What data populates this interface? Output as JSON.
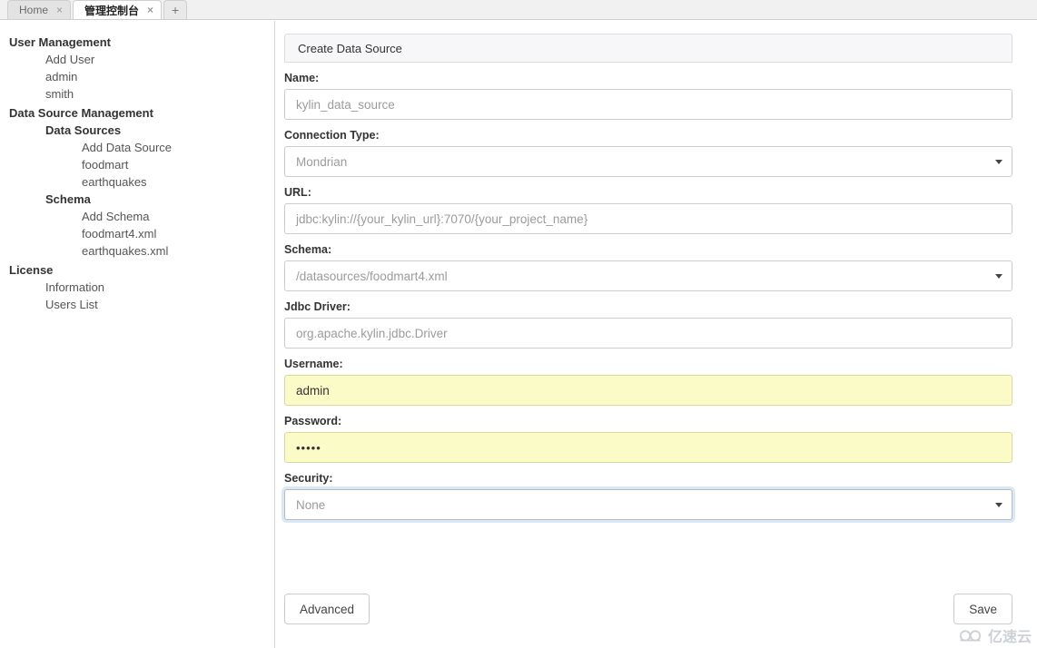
{
  "browser": {
    "tabs": [
      {
        "label": "Home",
        "active": false,
        "close_icon": "×"
      },
      {
        "label": "管理控制台",
        "active": true,
        "close_icon": "×"
      }
    ],
    "new_tab_label": "+"
  },
  "sidebar": {
    "items": [
      {
        "label": "User Management",
        "level": 0,
        "bold": true
      },
      {
        "label": "Add User",
        "level": 1,
        "bold": false
      },
      {
        "label": "admin",
        "level": 1,
        "bold": false
      },
      {
        "label": "smith",
        "level": 1,
        "bold": false
      },
      {
        "label": "Data Source Management",
        "level": 0,
        "bold": true
      },
      {
        "label": "Data Sources",
        "level": 1,
        "bold": true
      },
      {
        "label": "Add Data Source",
        "level": 2,
        "bold": false
      },
      {
        "label": "foodmart",
        "level": 2,
        "bold": false
      },
      {
        "label": "earthquakes",
        "level": 2,
        "bold": false
      },
      {
        "label": "Schema",
        "level": 1,
        "bold": true
      },
      {
        "label": "Add Schema",
        "level": 2,
        "bold": false
      },
      {
        "label": "foodmart4.xml",
        "level": 2,
        "bold": false
      },
      {
        "label": "earthquakes.xml",
        "level": 2,
        "bold": false
      },
      {
        "label": "License",
        "level": 0,
        "bold": true
      },
      {
        "label": "Information",
        "level": 1,
        "bold": false
      },
      {
        "label": "Users List",
        "level": 1,
        "bold": false
      }
    ]
  },
  "panel": {
    "title": "Create Data Source",
    "fields": {
      "name": {
        "label": "Name:",
        "value": "kylin_data_source",
        "placeholder": "kylin_data_source"
      },
      "connection_type": {
        "label": "Connection Type:",
        "value": "Mondrian",
        "options": [
          "Mondrian"
        ]
      },
      "url": {
        "label": "URL:",
        "value": "jdbc:kylin://{your_kylin_url}:7070/{your_project_name}",
        "placeholder": "jdbc:kylin://{your_kylin_url}:7070/{your_project_name}"
      },
      "schema": {
        "label": "Schema:",
        "value": "/datasources/foodmart4.xml",
        "options": [
          "/datasources/foodmart4.xml"
        ]
      },
      "jdbc_driver": {
        "label": "Jdbc Driver:",
        "value": "org.apache.kylin.jdbc.Driver",
        "placeholder": "org.apache.kylin.jdbc.Driver"
      },
      "username": {
        "label": "Username:",
        "value": "admin"
      },
      "password": {
        "label": "Password:",
        "value": "•••••"
      },
      "security": {
        "label": "Security:",
        "value": "None",
        "options": [
          "None"
        ]
      }
    }
  },
  "footer": {
    "advanced_label": "Advanced",
    "save_label": "Save"
  },
  "watermark": {
    "text": "亿速云"
  },
  "colors": {
    "autofill_background": "#fbfbc8",
    "autofill_border": "#d8d8a0",
    "focus_ring": "#d8e9f5",
    "panel_header_background": "#f7f7f9",
    "border": "#cccccc"
  }
}
